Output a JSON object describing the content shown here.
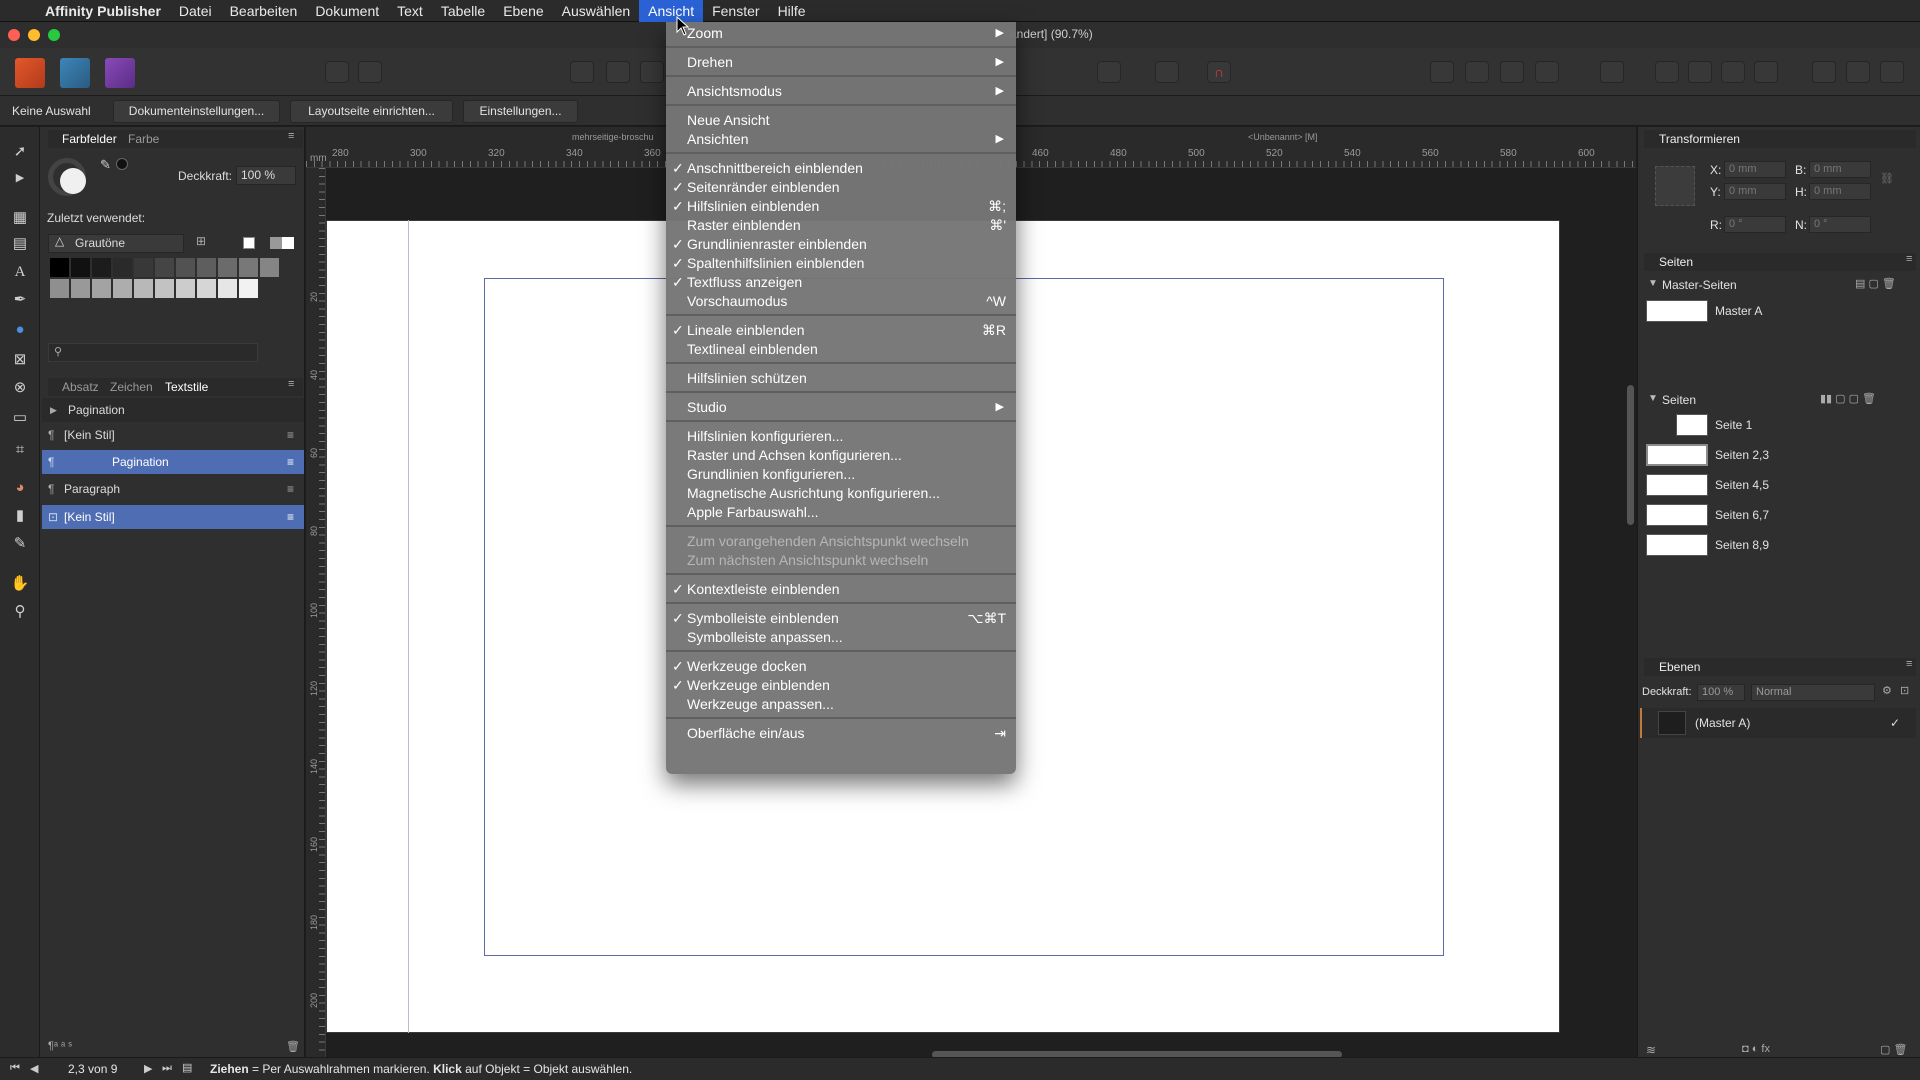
{
  "menubar": {
    "apple": "",
    "app_name": "Affinity Publisher",
    "items": [
      "Datei",
      "Bearbeiten",
      "Dokument",
      "Text",
      "Tabelle",
      "Ebene",
      "Auswählen",
      "Ansicht",
      "Fenster",
      "Hilfe"
    ],
    "active": "Ansicht"
  },
  "window": {
    "title_fragment": "ändert] (90.7%)"
  },
  "contextbar": {
    "selection": "Keine Auswahl",
    "buttons": [
      "Dokumenteinstellungen...",
      "Layoutseite einrichten...",
      "Einstellungen..."
    ]
  },
  "left_panel": {
    "tabs": [
      "Farbfelder",
      "Farbe"
    ],
    "opacity_label": "Deckkraft:",
    "opacity_value": "100 %",
    "recent_label": "Zuletzt verwendet:",
    "palette_name": "Grautöne",
    "text_tabs": [
      "Absatz",
      "Zeichen",
      "Textstile"
    ],
    "style_group": "Pagination",
    "styles": [
      "[Kein Stil]",
      "Pagination",
      "Paragraph",
      "[Kein Stil]"
    ]
  },
  "rulers": {
    "h_ticks": [
      "280",
      "300",
      "320",
      "340",
      "360",
      "460",
      "480",
      "500",
      "520",
      "540",
      "560",
      "580",
      "600"
    ],
    "v_ticks": [
      "20",
      "40",
      "60",
      "80",
      "100",
      "120",
      "140",
      "160",
      "180",
      "200"
    ],
    "spread_label_left": "mehrseitige-broschu",
    "spread_label_right": "<Unbenannt> [M]",
    "unit": "mm"
  },
  "view_menu": {
    "items": [
      {
        "label": "Zoom",
        "checked": false,
        "shortcut": "",
        "submenu": true,
        "disabled": false
      },
      {
        "sep": true
      },
      {
        "label": "Drehen",
        "checked": false,
        "shortcut": "",
        "submenu": true,
        "disabled": false
      },
      {
        "sep": true
      },
      {
        "label": "Ansichtsmodus",
        "checked": false,
        "shortcut": "",
        "submenu": true,
        "disabled": false
      },
      {
        "sep": true
      },
      {
        "label": "Neue Ansicht",
        "checked": false,
        "shortcut": "",
        "submenu": false,
        "disabled": false
      },
      {
        "label": "Ansichten",
        "checked": false,
        "shortcut": "",
        "submenu": true,
        "disabled": false
      },
      {
        "sep": true
      },
      {
        "label": "Anschnittbereich einblenden",
        "checked": true,
        "shortcut": "",
        "submenu": false,
        "disabled": false
      },
      {
        "label": "Seitenränder einblenden",
        "checked": true,
        "shortcut": "",
        "submenu": false,
        "disabled": false
      },
      {
        "label": "Hilfslinien einblenden",
        "checked": true,
        "shortcut": "⌘;",
        "submenu": false,
        "disabled": false
      },
      {
        "label": "Raster einblenden",
        "checked": false,
        "shortcut": "⌘'",
        "submenu": false,
        "disabled": false
      },
      {
        "label": "Grundlinienraster einblenden",
        "checked": true,
        "shortcut": "",
        "submenu": false,
        "disabled": false
      },
      {
        "label": "Spaltenhilfslinien einblenden",
        "checked": true,
        "shortcut": "",
        "submenu": false,
        "disabled": false
      },
      {
        "label": "Textfluss anzeigen",
        "checked": true,
        "shortcut": "",
        "submenu": false,
        "disabled": false
      },
      {
        "label": "Vorschaumodus",
        "checked": false,
        "shortcut": "^W",
        "submenu": false,
        "disabled": false
      },
      {
        "sep": true
      },
      {
        "label": "Lineale einblenden",
        "checked": true,
        "shortcut": "⌘R",
        "submenu": false,
        "disabled": false
      },
      {
        "label": "Textlineal einblenden",
        "checked": false,
        "shortcut": "",
        "submenu": false,
        "disabled": false
      },
      {
        "sep": true
      },
      {
        "label": "Hilfslinien schützen",
        "checked": false,
        "shortcut": "",
        "submenu": false,
        "disabled": false
      },
      {
        "sep": true
      },
      {
        "label": "Studio",
        "checked": false,
        "shortcut": "",
        "submenu": true,
        "disabled": false
      },
      {
        "sep": true
      },
      {
        "label": "Hilfslinien konfigurieren...",
        "checked": false,
        "shortcut": "",
        "submenu": false,
        "disabled": false
      },
      {
        "label": "Raster und Achsen konfigurieren...",
        "checked": false,
        "shortcut": "",
        "submenu": false,
        "disabled": false
      },
      {
        "label": "Grundlinien konfigurieren...",
        "checked": false,
        "shortcut": "",
        "submenu": false,
        "disabled": false
      },
      {
        "label": "Magnetische Ausrichtung konfigurieren...",
        "checked": false,
        "shortcut": "",
        "submenu": false,
        "disabled": false
      },
      {
        "label": "Apple Farbauswahl...",
        "checked": false,
        "shortcut": "",
        "submenu": false,
        "disabled": false
      },
      {
        "sep": true
      },
      {
        "label": "Zum vorangehenden Ansichtspunkt wechseln",
        "checked": false,
        "shortcut": "",
        "submenu": false,
        "disabled": true
      },
      {
        "label": "Zum nächsten Ansichtspunkt wechseln",
        "checked": false,
        "shortcut": "",
        "submenu": false,
        "disabled": true
      },
      {
        "sep": true
      },
      {
        "label": "Kontextleiste einblenden",
        "checked": true,
        "shortcut": "",
        "submenu": false,
        "disabled": false
      },
      {
        "sep": true
      },
      {
        "label": "Symbolleiste einblenden",
        "checked": true,
        "shortcut": "⌥⌘T",
        "submenu": false,
        "disabled": false
      },
      {
        "label": "Symbolleiste anpassen...",
        "checked": false,
        "shortcut": "",
        "submenu": false,
        "disabled": false
      },
      {
        "sep": true
      },
      {
        "label": "Werkzeuge docken",
        "checked": true,
        "shortcut": "",
        "submenu": false,
        "disabled": false
      },
      {
        "label": "Werkzeuge einblenden",
        "checked": true,
        "shortcut": "",
        "submenu": false,
        "disabled": false
      },
      {
        "label": "Werkzeuge anpassen...",
        "checked": false,
        "shortcut": "",
        "submenu": false,
        "disabled": false
      },
      {
        "sep": true
      },
      {
        "label": "Oberfläche ein/aus",
        "checked": false,
        "shortcut": "⇥",
        "submenu": false,
        "disabled": false
      }
    ]
  },
  "right_panel": {
    "transform": {
      "title": "Transformieren",
      "x_label": "X:",
      "x_value": "0 mm",
      "y_label": "Y:",
      "y_value": "0 mm",
      "h_label": "B:",
      "h_value": "0 mm",
      "hh_label": "H:",
      "hh_value": "0 mm",
      "r_label": "R:",
      "r_value": "0 °",
      "n_label": "N:",
      "n_value": "0 °"
    },
    "pages": {
      "title": "Seiten",
      "master_header": "Master-Seiten",
      "masters": [
        "Master A"
      ],
      "pages_header": "Seiten",
      "pages": [
        "Seite 1",
        "Seiten 2,3",
        "Seiten 4,5",
        "Seiten 6,7",
        "Seiten 8,9"
      ],
      "selected": "Seiten 2,3"
    },
    "layers": {
      "title": "Ebenen",
      "opacity_label": "Deckkraft:",
      "opacity_value": "100 %",
      "blend_mode": "Normal",
      "layer_name": "(Master A)"
    }
  },
  "status": {
    "page_indicator": "2,3 von 9",
    "hint_bold1": "Ziehen",
    "hint1": " = Per Auswahlrahmen markieren. ",
    "hint_bold2": "Klick",
    "hint2": " auf Objekt = Objekt auswählen."
  },
  "colors": {
    "accent": "#2a62d6",
    "selection_row": "#4f6db3",
    "margin_guide": "#5b6aa8"
  }
}
